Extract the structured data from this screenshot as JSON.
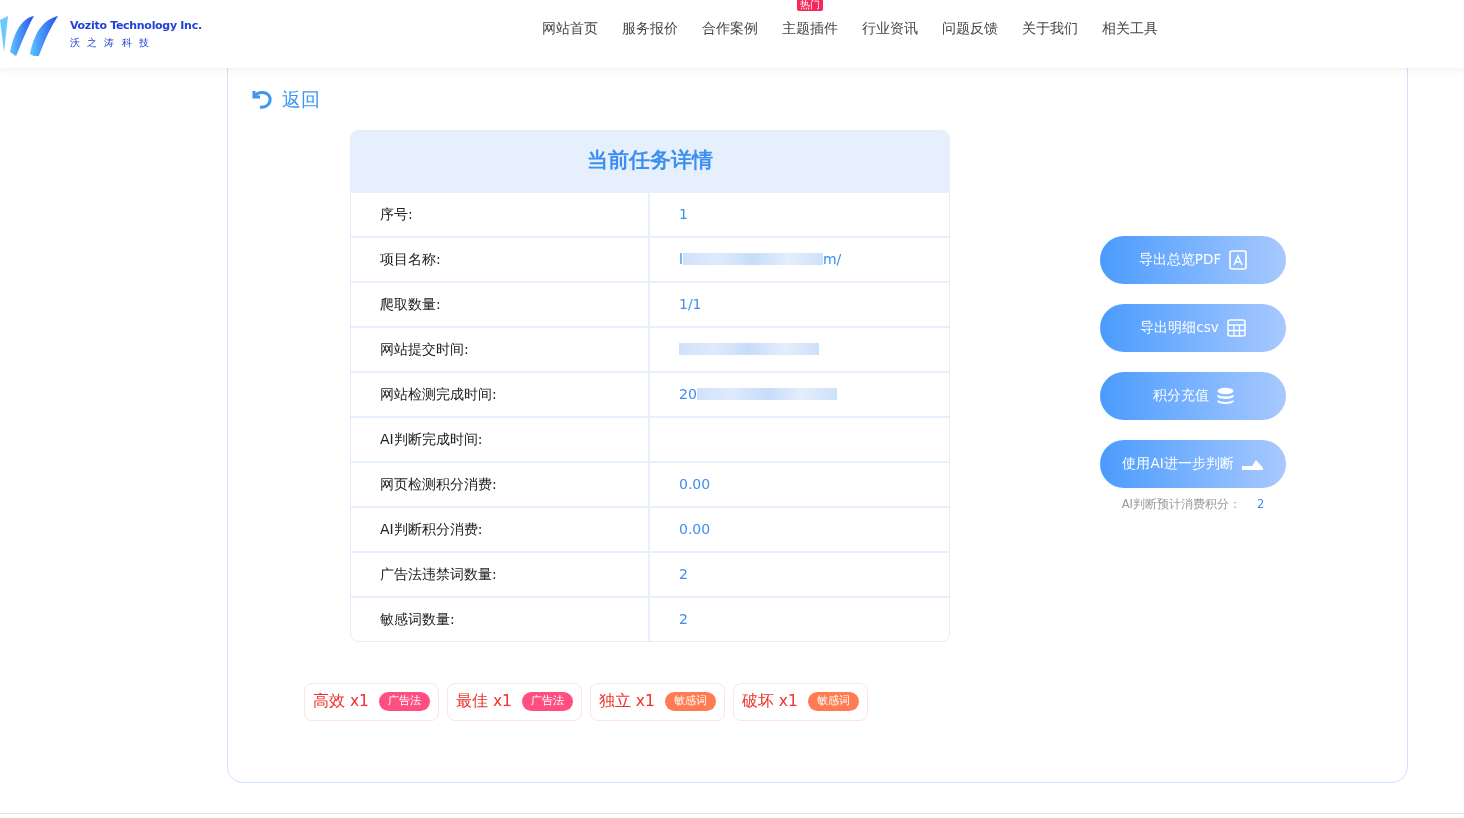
{
  "logo": {
    "name_en": "Vozito Technology Inc.",
    "name_zh": "沃 之 涛 科 技"
  },
  "nav": [
    {
      "label": "网站首页"
    },
    {
      "label": "服务报价"
    },
    {
      "label": "合作案例"
    },
    {
      "label": "主题插件",
      "badge": "热门"
    },
    {
      "label": "行业资讯"
    },
    {
      "label": "问题反馈"
    },
    {
      "label": "关于我们"
    },
    {
      "label": "相关工具"
    }
  ],
  "back": "返回",
  "details": {
    "title": "当前任务详情",
    "rows": [
      {
        "label": "序号:",
        "value": "1"
      },
      {
        "label": "项目名称:",
        "prefix": "l",
        "suffix": "m/",
        "kind": "redacted"
      },
      {
        "label": "爬取数量:",
        "value": "1/1"
      },
      {
        "label": "网站提交时间:",
        "kind": "redacted"
      },
      {
        "label": "网站检测完成时间:",
        "prefix": "20",
        "kind": "redacted"
      },
      {
        "label": "AI判断完成时间:"
      },
      {
        "label": "网页检测积分消费:",
        "value": "0.00"
      },
      {
        "label": "AI判断积分消费:",
        "value": "0.00"
      },
      {
        "label": "广告法违禁词数量:",
        "value": "2"
      },
      {
        "label": "敏感词数量:",
        "value": "2"
      }
    ]
  },
  "actions": [
    {
      "label": "导出总览PDF",
      "kind": "pdf"
    },
    {
      "label": "导出明细csv",
      "kind": "table"
    },
    {
      "label": "积分充值",
      "kind": "coins"
    },
    {
      "label": "使用AI进一步判断",
      "kind": "ai"
    }
  ],
  "ai_cost": {
    "label": "AI判断预计消费积分：",
    "value": "2"
  },
  "words": [
    {
      "word": "高效 x1",
      "tag": "广告法",
      "color": "#ff4f81"
    },
    {
      "word": "最佳 x1",
      "tag": "广告法",
      "color": "#ff4f81"
    },
    {
      "word": "独立 x1",
      "tag": "敏感词",
      "color": "#ff7b52"
    },
    {
      "word": "破坏 x1",
      "tag": "敏感词",
      "color": "#ff7b52"
    }
  ]
}
